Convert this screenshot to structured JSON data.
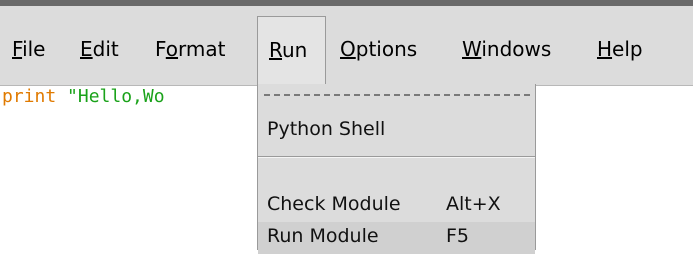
{
  "menubar": {
    "items": [
      {
        "mnemonic": "F",
        "rest": "ile"
      },
      {
        "mnemonic": "E",
        "rest": "dit"
      },
      {
        "pre": "F",
        "mnemonic": "o",
        "rest": "rmat"
      },
      {
        "mnemonic": "R",
        "rest": "un"
      },
      {
        "mnemonic": "O",
        "rest": "ptions"
      },
      {
        "mnemonic": "W",
        "rest": "indows"
      },
      {
        "mnemonic": "H",
        "rest": "elp"
      }
    ]
  },
  "editor": {
    "keyword": "print",
    "string": "\"Hello,Wo"
  },
  "run_menu": {
    "items": [
      {
        "label": "Python Shell",
        "accelerator": ""
      },
      {
        "label": "Check Module",
        "accelerator": "Alt+X"
      },
      {
        "label": "Run Module",
        "accelerator": "F5"
      }
    ]
  },
  "colors": {
    "keyword": "#e07a00",
    "string": "#1aa21a",
    "menubar_bg": "#dcdcdc"
  }
}
